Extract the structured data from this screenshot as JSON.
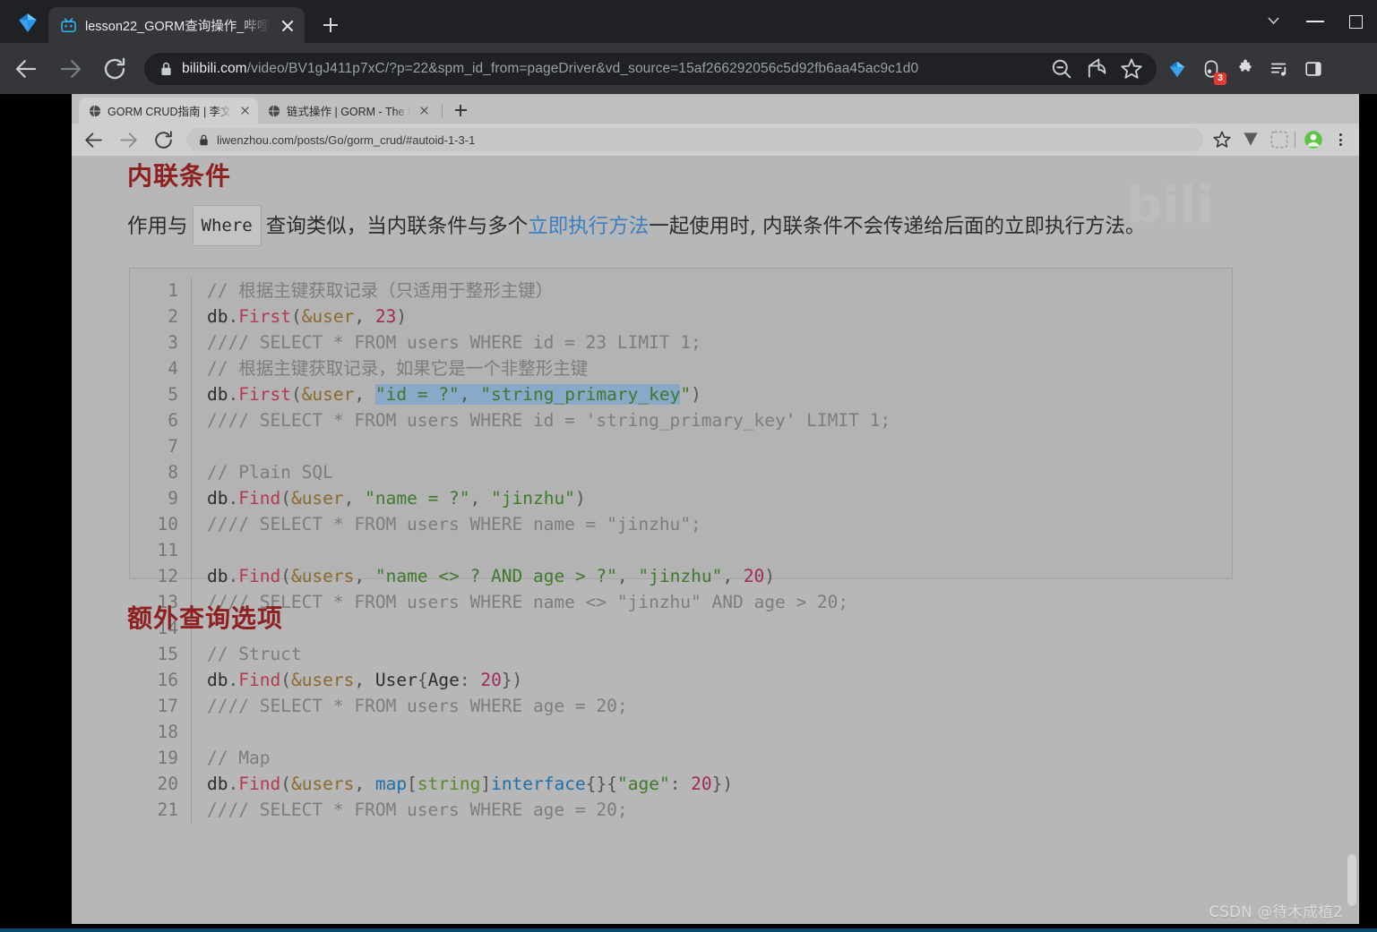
{
  "outer_browser": {
    "profile_icon": "diamond-gem-icon",
    "tab": {
      "favicon": "bilibili-icon",
      "title": "lesson22_GORM查询操作_哔哩",
      "close_label": "×"
    },
    "new_tab_label": "+",
    "window_controls": [
      "chevron-down-icon",
      "minimize-icon",
      "maximize-icon"
    ],
    "nav": {
      "back": "back-arrow-icon",
      "forward": "forward-arrow-icon",
      "reload": "reload-icon"
    },
    "omnibox": {
      "lock": "lock-icon",
      "host": "bilibili.com",
      "path": "/video/BV1gJ411p7xC/?p=22&spm_id_from=pageDriver&vd_source=15af266292056c5d92fb6aa45ac9c1d0",
      "zoom_out_icon": "zoom-out-icon",
      "share_icon": "share-icon",
      "bookmark_icon": "star-icon"
    },
    "toolbar_right": [
      {
        "name": "diamond-gem-icon",
        "badge": ""
      },
      {
        "name": "extension-capsule-icon",
        "badge": "3"
      },
      {
        "name": "puzzle-extensions-icon",
        "badge": ""
      },
      {
        "name": "reading-list-icon",
        "badge": ""
      },
      {
        "name": "side-panel-icon",
        "badge": ""
      }
    ]
  },
  "inner_browser": {
    "tabs": [
      {
        "favicon": "globe-icon",
        "title": "GORM CRUD指南 | 李文周的博",
        "active": true,
        "close": "×"
      },
      {
        "favicon": "globe-icon",
        "title": "链式操作 | GORM - The fantast",
        "active": false,
        "close": "×"
      }
    ],
    "new_tab_label": "+",
    "nav": {
      "back": "back-arrow-icon",
      "forward": "forward-arrow-icon",
      "reload": "reload-icon"
    },
    "omnibox": {
      "lock": "lock-icon",
      "url": "liwenzhou.com/posts/Go/gorm_crud/#autoid-1-3-1"
    },
    "toolbar_right": [
      "star-icon",
      "download-arrow-icon",
      "extension-icon",
      "profile-avatar-icon",
      "kebab-menu-icon"
    ]
  },
  "page": {
    "heading": "内联条件",
    "paragraph": {
      "part1": "作用与",
      "code_badge": "Where",
      "part2": "查询类似，当内联条件与多个",
      "link": "立即执行方法",
      "part3": "一起使用时, 内联条件不会传递给后面的立即执行方法。"
    },
    "bottom_heading": "额外查询选项",
    "watermark": "CSDN @待木成植2"
  },
  "code": {
    "language": "go",
    "lines": [
      {
        "n": "1",
        "tokens": [
          {
            "t": "// 根据主键获取记录（只适用于整形主键）",
            "c": "cm"
          }
        ]
      },
      {
        "n": "2",
        "tokens": [
          {
            "t": "db",
            "c": "pn2"
          },
          {
            "t": ".",
            "c": "pn"
          },
          {
            "t": "First",
            "c": "fn"
          },
          {
            "t": "(",
            "c": "pn"
          },
          {
            "t": "&user",
            "c": "pk"
          },
          {
            "t": ", ",
            "c": "pn"
          },
          {
            "t": "23",
            "c": "nu"
          },
          {
            "t": ")",
            "c": "pn"
          }
        ]
      },
      {
        "n": "3",
        "tokens": [
          {
            "t": "//// SELECT * FROM users WHERE id = 23 LIMIT 1;",
            "c": "cm"
          }
        ]
      },
      {
        "n": "4",
        "tokens": [
          {
            "t": "// 根据主键获取记录，如果它是一个非整形主键",
            "c": "cm"
          }
        ]
      },
      {
        "n": "5",
        "tokens": [
          {
            "t": "db",
            "c": "pn2"
          },
          {
            "t": ".",
            "c": "pn"
          },
          {
            "t": "First",
            "c": "fn"
          },
          {
            "t": "(",
            "c": "pn"
          },
          {
            "t": "&user",
            "c": "pk"
          },
          {
            "t": ", ",
            "c": "pn"
          },
          {
            "t": "\"id = ?\"",
            "c": "st sel"
          },
          {
            "t": ", ",
            "c": "pn sel"
          },
          {
            "t": "\"string_primary_key",
            "c": "st sel"
          },
          {
            "t": "\"",
            "c": "st"
          },
          {
            "t": ")",
            "c": "pn"
          }
        ]
      },
      {
        "n": "6",
        "tokens": [
          {
            "t": "//// SELECT * FROM users WHERE id = 'string_primary_key' LIMIT 1;",
            "c": "cm"
          }
        ]
      },
      {
        "n": "7",
        "tokens": []
      },
      {
        "n": "8",
        "tokens": [
          {
            "t": "// Plain SQL",
            "c": "cm"
          }
        ]
      },
      {
        "n": "9",
        "tokens": [
          {
            "t": "db",
            "c": "pn2"
          },
          {
            "t": ".",
            "c": "pn"
          },
          {
            "t": "Find",
            "c": "fn"
          },
          {
            "t": "(",
            "c": "pn"
          },
          {
            "t": "&user",
            "c": "pk"
          },
          {
            "t": ", ",
            "c": "pn"
          },
          {
            "t": "\"name = ?\"",
            "c": "st"
          },
          {
            "t": ", ",
            "c": "pn"
          },
          {
            "t": "\"jinzhu\"",
            "c": "st"
          },
          {
            "t": ")",
            "c": "pn"
          }
        ]
      },
      {
        "n": "10",
        "tokens": [
          {
            "t": "//// SELECT * FROM users WHERE name = \"jinzhu\";",
            "c": "cm"
          }
        ]
      },
      {
        "n": "11",
        "tokens": []
      },
      {
        "n": "12",
        "tokens": [
          {
            "t": "db",
            "c": "pn2"
          },
          {
            "t": ".",
            "c": "pn"
          },
          {
            "t": "Find",
            "c": "fn"
          },
          {
            "t": "(",
            "c": "pn"
          },
          {
            "t": "&users",
            "c": "pk"
          },
          {
            "t": ", ",
            "c": "pn"
          },
          {
            "t": "\"name <> ? AND age > ?\"",
            "c": "st"
          },
          {
            "t": ", ",
            "c": "pn"
          },
          {
            "t": "\"jinzhu\"",
            "c": "st"
          },
          {
            "t": ", ",
            "c": "pn"
          },
          {
            "t": "20",
            "c": "nu"
          },
          {
            "t": ")",
            "c": "pn"
          }
        ]
      },
      {
        "n": "13",
        "tokens": [
          {
            "t": "//// SELECT * FROM users WHERE name <> \"jinzhu\" AND age > 20;",
            "c": "cm"
          }
        ]
      },
      {
        "n": "14",
        "tokens": []
      },
      {
        "n": "15",
        "tokens": [
          {
            "t": "// Struct",
            "c": "cm"
          }
        ]
      },
      {
        "n": "16",
        "tokens": [
          {
            "t": "db",
            "c": "pn2"
          },
          {
            "t": ".",
            "c": "pn"
          },
          {
            "t": "Find",
            "c": "fn"
          },
          {
            "t": "(",
            "c": "pn"
          },
          {
            "t": "&users",
            "c": "pk"
          },
          {
            "t": ", ",
            "c": "pn"
          },
          {
            "t": "User",
            "c": "pn2"
          },
          {
            "t": "{",
            "c": "pn"
          },
          {
            "t": "Age",
            "c": "pn2"
          },
          {
            "t": ": ",
            "c": "pn"
          },
          {
            "t": "20",
            "c": "nu"
          },
          {
            "t": "})",
            "c": "pn"
          }
        ]
      },
      {
        "n": "17",
        "tokens": [
          {
            "t": "//// SELECT * FROM users WHERE age = 20;",
            "c": "cm"
          }
        ]
      },
      {
        "n": "18",
        "tokens": []
      },
      {
        "n": "19",
        "tokens": [
          {
            "t": "// Map",
            "c": "cm"
          }
        ]
      },
      {
        "n": "20",
        "tokens": [
          {
            "t": "db",
            "c": "pn2"
          },
          {
            "t": ".",
            "c": "pn"
          },
          {
            "t": "Find",
            "c": "fn"
          },
          {
            "t": "(",
            "c": "pn"
          },
          {
            "t": "&users",
            "c": "pk"
          },
          {
            "t": ", ",
            "c": "pn"
          },
          {
            "t": "map",
            "c": "kw"
          },
          {
            "t": "[",
            "c": "pn"
          },
          {
            "t": "string",
            "c": "ty"
          },
          {
            "t": "]",
            "c": "pn"
          },
          {
            "t": "interface",
            "c": "kw"
          },
          {
            "t": "{}{",
            "c": "pn"
          },
          {
            "t": "\"age\"",
            "c": "st"
          },
          {
            "t": ": ",
            "c": "pn"
          },
          {
            "t": "20",
            "c": "nu"
          },
          {
            "t": "})",
            "c": "pn"
          }
        ]
      },
      {
        "n": "21",
        "tokens": [
          {
            "t": "//// SELECT * FROM users WHERE age = 20;",
            "c": "cm"
          }
        ]
      }
    ]
  },
  "colors": {
    "outer_chrome_bg": "#202124",
    "outer_tab_bg": "#35363a",
    "heading_red": "#8e2020",
    "link_blue": "#3a7fc4",
    "selection_blue": "#8aa8c8",
    "badge_red": "#e53935",
    "page_gray": "#b7b7b7"
  }
}
